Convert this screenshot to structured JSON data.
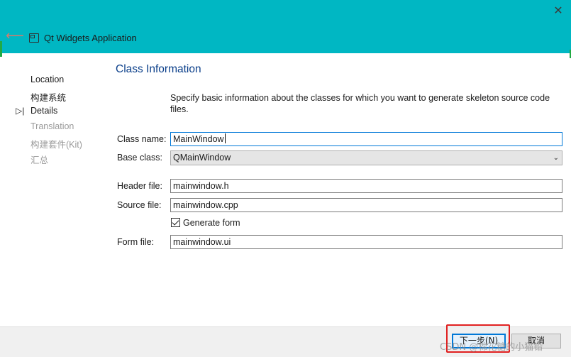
{
  "window": {
    "title": "Qt Widgets Application",
    "close_glyph": "✕",
    "back_glyph": "⟵",
    "accent_color": "#00b7c3"
  },
  "sidebar": {
    "current_marker": "▷|",
    "items": [
      {
        "label": "Location",
        "state": "done"
      },
      {
        "label": "构建系统",
        "state": "done"
      },
      {
        "label": "Details",
        "state": "current"
      },
      {
        "label": "Translation",
        "state": "todo"
      },
      {
        "label": "构建套件(Kit)",
        "state": "todo"
      },
      {
        "label": "汇总",
        "state": "todo"
      }
    ]
  },
  "page": {
    "title": "Class Information",
    "description": "Specify basic information about the classes for which you want to generate skeleton source code files."
  },
  "form": {
    "class_name_label": "Class name:",
    "class_name_value": "MainWindow",
    "base_class_label": "Base class:",
    "base_class_value": "QMainWindow",
    "header_file_label": "Header file:",
    "header_file_value": "mainwindow.h",
    "source_file_label": "Source file:",
    "source_file_value": "mainwindow.cpp",
    "generate_form_label": "Generate form",
    "generate_form_checked": true,
    "form_file_label": "Form file:",
    "form_file_value": "mainwindow.ui"
  },
  "footer": {
    "next_label": "下一步(N)",
    "cancel_label": "取消",
    "watermark": "CSDN @棉花糖的小猫铅"
  }
}
